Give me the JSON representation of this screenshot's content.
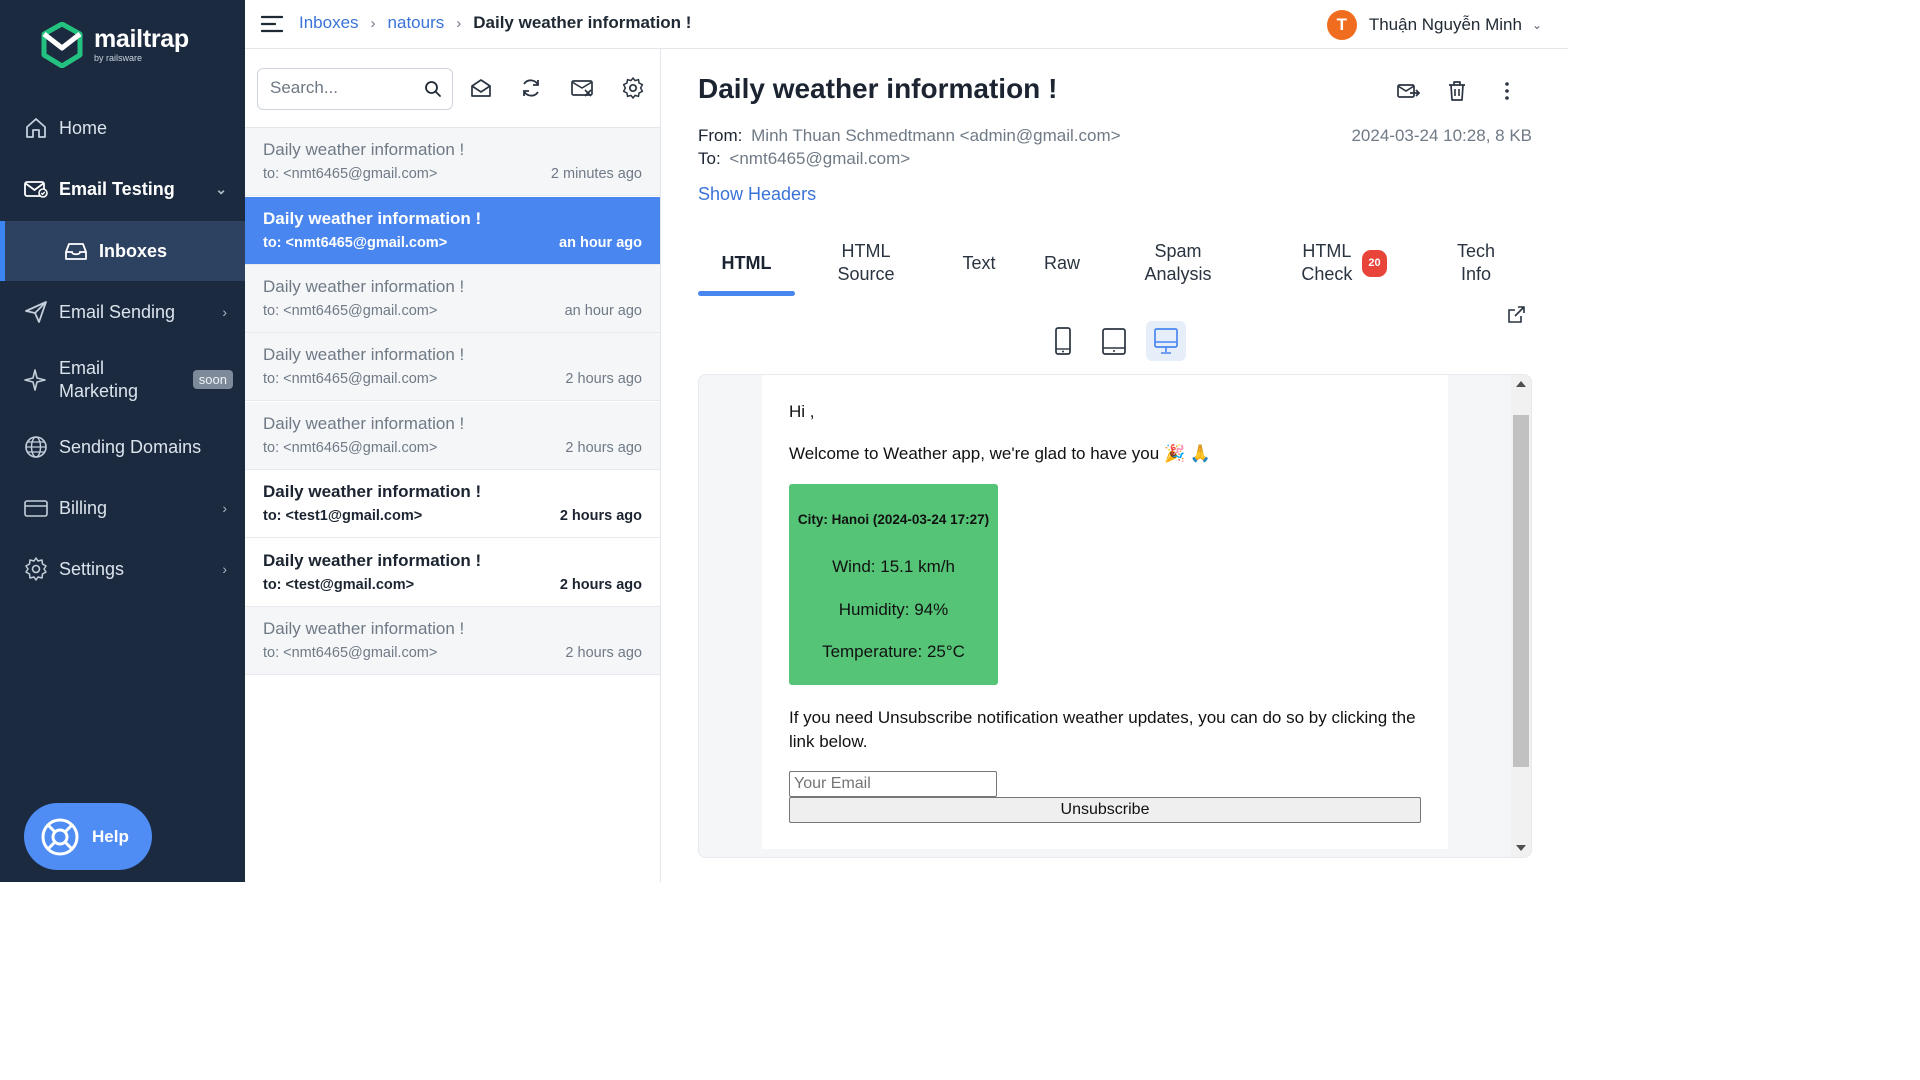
{
  "brand": {
    "name": "mailtrap",
    "sub": "by railsware",
    "color": "#24c281"
  },
  "sidebar": {
    "items": [
      {
        "label": "Home",
        "icon": "home-icon"
      },
      {
        "label": "Email Testing",
        "icon": "email-testing-icon"
      },
      {
        "label": "Inboxes",
        "icon": "inbox-icon"
      },
      {
        "label": "Email Sending",
        "icon": "send-icon"
      },
      {
        "label": "Email Marketing",
        "icon": "sparkle-icon",
        "badge": "soon"
      },
      {
        "label": "Sending Domains",
        "icon": "globe-icon"
      },
      {
        "label": "Billing",
        "icon": "billing-icon"
      },
      {
        "label": "Settings",
        "icon": "gear-icon"
      }
    ],
    "marketing_line1": "Email",
    "marketing_line2": "Marketing",
    "help": "Help"
  },
  "topbar": {
    "breadcrumb": [
      "Inboxes",
      "natours",
      "Daily weather information !"
    ],
    "user_initial": "T",
    "user_name": "Thuận Nguyễn Minh"
  },
  "search": {
    "placeholder": "Search..."
  },
  "messages": [
    {
      "subject": "Daily weather information !",
      "to": "to: <nmt6465@gmail.com>",
      "time": "2 minutes ago",
      "state": "read"
    },
    {
      "subject": "Daily weather information !",
      "to": "to: <nmt6465@gmail.com>",
      "time": "an hour ago",
      "state": "active"
    },
    {
      "subject": "Daily weather information !",
      "to": "to: <nmt6465@gmail.com>",
      "time": "an hour ago",
      "state": "read"
    },
    {
      "subject": "Daily weather information !",
      "to": "to: <nmt6465@gmail.com>",
      "time": "2 hours ago",
      "state": "read"
    },
    {
      "subject": "Daily weather information !",
      "to": "to: <nmt6465@gmail.com>",
      "time": "2 hours ago",
      "state": "read"
    },
    {
      "subject": "Daily weather information !",
      "to": "to: <test1@gmail.com>",
      "time": "2 hours ago",
      "state": "unread"
    },
    {
      "subject": "Daily weather information !",
      "to": "to: <test@gmail.com>",
      "time": "2 hours ago",
      "state": "unread"
    },
    {
      "subject": "Daily weather information !",
      "to": "to: <nmt6465@gmail.com>",
      "time": "2 hours ago",
      "state": "read"
    }
  ],
  "detail": {
    "title": "Daily weather information !",
    "from_label": "From:",
    "from_value": "Minh Thuan Schmedtmann <admin@gmail.com>",
    "to_label": "To:",
    "to_value": "<nmt6465@gmail.com>",
    "meta": "2024-03-24 10:28, 8 KB",
    "show_headers": "Show Headers",
    "tabs": [
      {
        "line1": "HTML",
        "line2": ""
      },
      {
        "line1": "HTML",
        "line2": "Source"
      },
      {
        "line1": "Text",
        "line2": ""
      },
      {
        "line1": "Raw",
        "line2": ""
      },
      {
        "line1": "Spam",
        "line2": "Analysis"
      },
      {
        "line1": "HTML",
        "line2": "Check",
        "badge": "20"
      },
      {
        "line1": "Tech",
        "line2": "Info"
      }
    ],
    "active_tab": "HTML"
  },
  "email": {
    "greeting": "Hi ,",
    "welcome": "Welcome to Weather app, we're glad to have you 🎉 🙏",
    "city": "City: Hanoi (2024-03-24 17:27)",
    "wind": "Wind: 15.1 km/h",
    "humidity": "Humidity: 94%",
    "temperature": "Temperature: 25°C",
    "unsubscribe_text": "If you need Unsubscribe notification weather updates, you can do so by clicking the link below.",
    "email_placeholder": "Your Email",
    "unsubscribe_button": "Unsubscribe"
  },
  "colors": {
    "sidebar_bg": "#1b2a3f",
    "accent": "#4a86ef",
    "card": "#55c476",
    "avatar": "#f06d1f",
    "badge": "#e8443a"
  }
}
